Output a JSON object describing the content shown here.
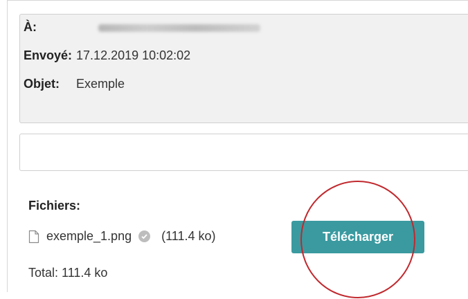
{
  "header": {
    "to_label": "À:",
    "sent_label": "Envoyé:",
    "sent_value": "17.12.2019 10:02:02",
    "subject_label": "Objet:",
    "subject_value": "Exemple"
  },
  "files": {
    "title": "Fichiers:",
    "items": [
      {
        "name": "exemple_1.png",
        "size": "(111.4 ko)",
        "icon": "file-icon",
        "status_icon": "check-circle-icon"
      }
    ],
    "download_label": "Télécharger",
    "total": "Total: 111.4 ko"
  },
  "colors": {
    "button": "#3a9aa0",
    "header_bg": "#f1f1f1",
    "annotation": "#c0282d"
  }
}
